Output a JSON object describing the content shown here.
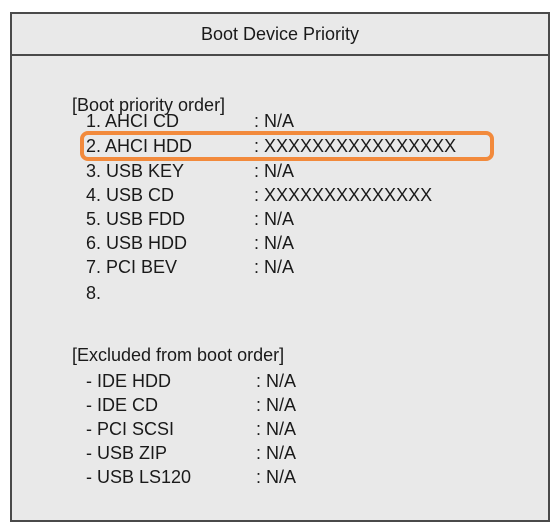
{
  "title": "Boot Device Priority",
  "priority_header": "[Boot priority order]",
  "priority_items": [
    {
      "label": "1. AHCI CD",
      "value": ": N/A"
    },
    {
      "label": "2. AHCI HDD",
      "value": ": XXXXXXXXXXXXXXXX"
    },
    {
      "label": "3. USB KEY",
      "value": ": N/A"
    },
    {
      "label": "4. USB CD",
      "value": ": XXXXXXXXXXXXXX"
    },
    {
      "label": "5. USB FDD",
      "value": ": N/A"
    },
    {
      "label": "6. USB HDD",
      "value": ": N/A"
    },
    {
      "label": "7. PCI BEV",
      "value": ": N/A"
    },
    {
      "label": "8.",
      "value": ""
    }
  ],
  "excluded_header": "[Excluded from boot order]",
  "excluded_items": [
    {
      "label": "- IDE HDD",
      "value": ": N/A"
    },
    {
      "label": "- IDE CD",
      "value": ": N/A"
    },
    {
      "label": "- PCI SCSI",
      "value": ": N/A"
    },
    {
      "label": "- USB ZIP",
      "value": ": N/A"
    },
    {
      "label": "- USB LS120",
      "value": ": N/A"
    }
  ],
  "colors": {
    "highlight": "#f28a3c",
    "background": "#e9e9e9",
    "border": "#4a4a4a"
  }
}
